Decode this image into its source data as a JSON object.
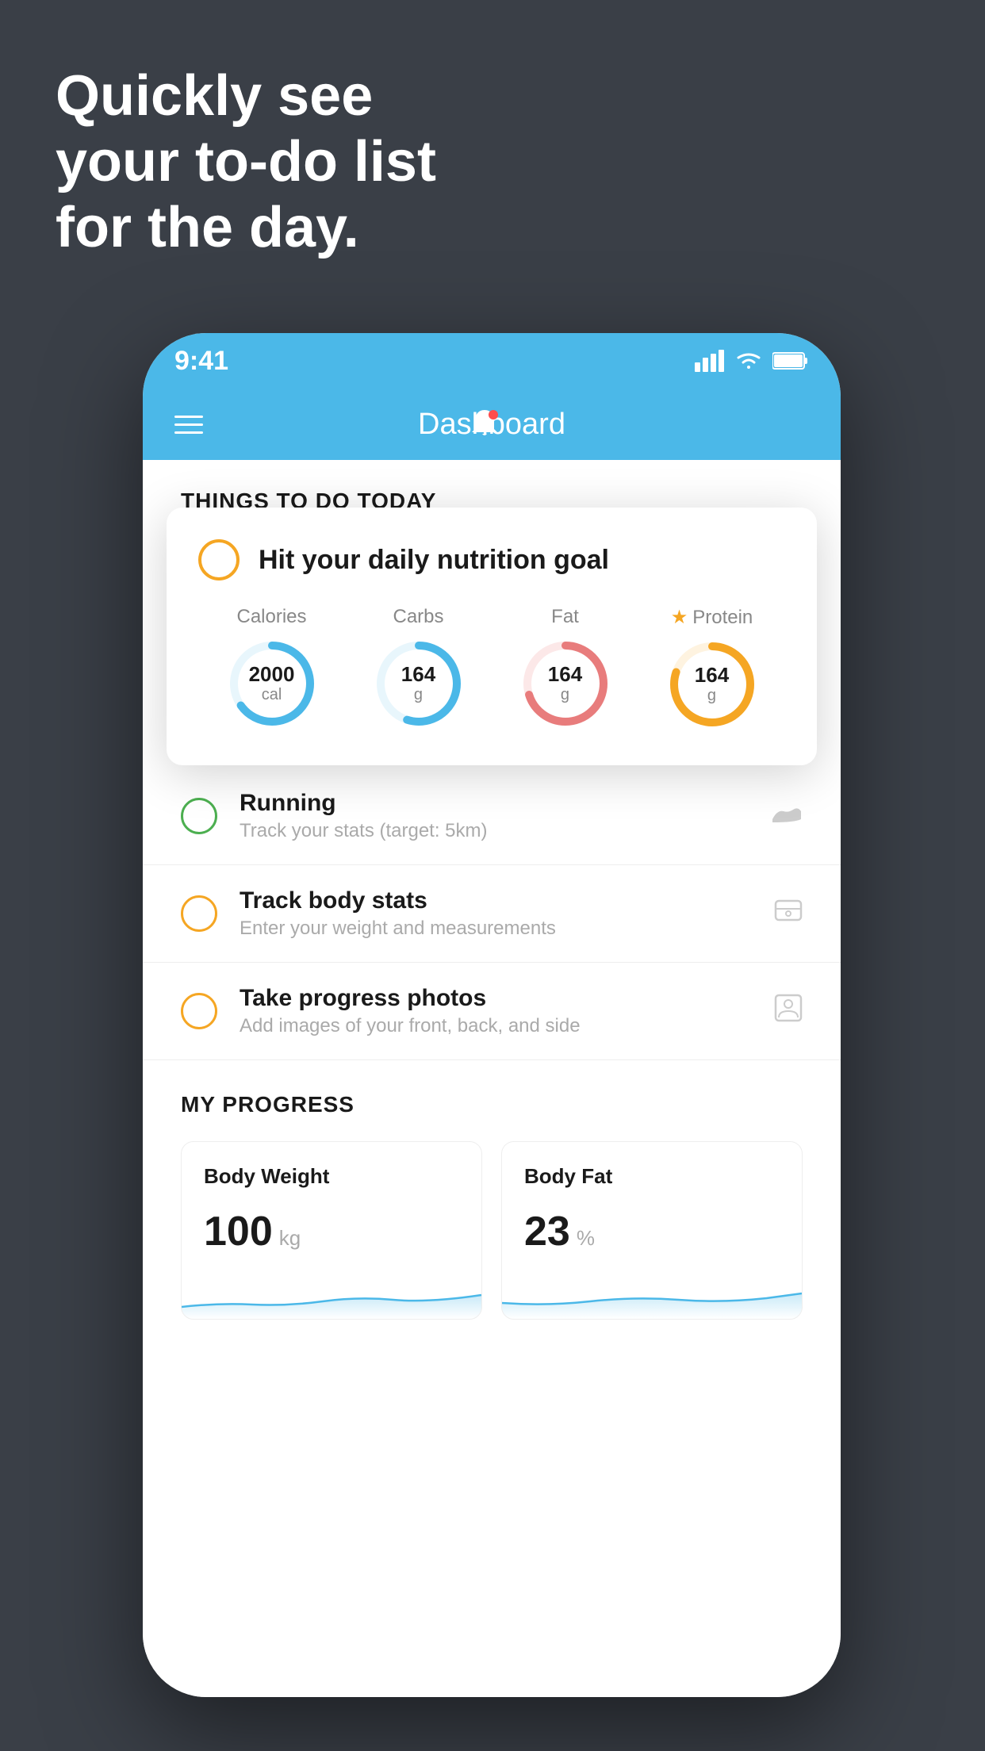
{
  "hero": {
    "line1": "Quickly see",
    "line2": "your to-do list",
    "line3": "for the day."
  },
  "status_bar": {
    "time": "9:41",
    "signal": "▎▎▎▎",
    "wifi": "wifi",
    "battery": "battery"
  },
  "nav": {
    "title": "Dashboard"
  },
  "things_today": {
    "heading": "THINGS TO DO TODAY"
  },
  "nutrition_card": {
    "title": "Hit your daily nutrition goal",
    "calories": {
      "label": "Calories",
      "value": "2000",
      "unit": "cal",
      "color": "#4bb8e8",
      "pct": 65
    },
    "carbs": {
      "label": "Carbs",
      "value": "164",
      "unit": "g",
      "color": "#4bb8e8",
      "pct": 55
    },
    "fat": {
      "label": "Fat",
      "value": "164",
      "unit": "g",
      "color": "#e87c7c",
      "pct": 70
    },
    "protein": {
      "label": "Protein",
      "value": "164",
      "unit": "g",
      "color": "#f5a623",
      "pct": 80
    }
  },
  "todo_items": [
    {
      "id": "running",
      "title": "Running",
      "sub": "Track your stats (target: 5km)",
      "circle_color": "green",
      "icon": "👟"
    },
    {
      "id": "body_stats",
      "title": "Track body stats",
      "sub": "Enter your weight and measurements",
      "circle_color": "orange",
      "icon": "⚖"
    },
    {
      "id": "photos",
      "title": "Take progress photos",
      "sub": "Add images of your front, back, and side",
      "circle_color": "orange",
      "icon": "🪞"
    }
  ],
  "progress": {
    "heading": "MY PROGRESS",
    "body_weight": {
      "title": "Body Weight",
      "value": "100",
      "unit": "kg"
    },
    "body_fat": {
      "title": "Body Fat",
      "value": "23",
      "unit": "%"
    }
  }
}
